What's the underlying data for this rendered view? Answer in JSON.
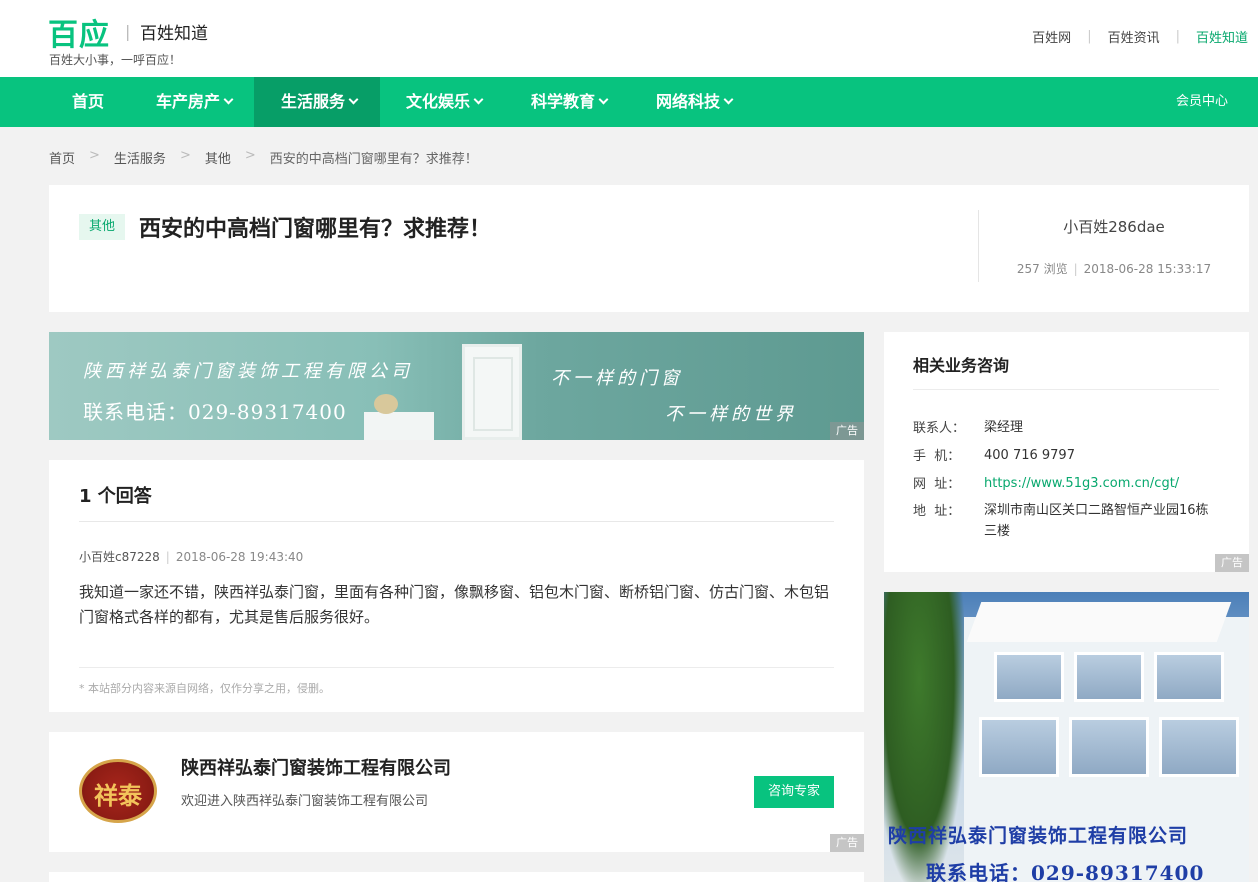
{
  "header": {
    "logo": "百应",
    "site_name": "百姓知道",
    "slogan": "百姓大小事，一呼百应！",
    "links": [
      "百姓网",
      "百姓资讯",
      "百姓知道"
    ]
  },
  "nav": {
    "items": [
      "首页",
      "车产房产",
      "生活服务",
      "文化娱乐",
      "科学教育",
      "网络科技"
    ],
    "active": "生活服务",
    "member": "会员中心"
  },
  "breadcrumb": [
    "首页",
    "生活服务",
    "其他",
    "西安的中高档门窗哪里有？求推荐！"
  ],
  "question": {
    "tag": "其他",
    "title": "西安的中高档门窗哪里有？求推荐！",
    "user": "小百姓286dae",
    "views": "257 浏览",
    "time": "2018-06-28 15:33:17"
  },
  "banner": {
    "company": "陕西祥弘泰门窗装饰工程有限公司",
    "phone": "联系电话：029-89317400",
    "slogan1": "不一样的门窗",
    "slogan2": "不一样的世界",
    "ad": "广告"
  },
  "answers": {
    "count": "1 个回答",
    "items": [
      {
        "user": "小百姓c87228",
        "time": "2018-06-28 19:43:40",
        "text": "我知道一家还不错，陕西祥弘泰门窗，里面有各种门窗，像飘移窗、铝包木门窗、断桥铝门窗、仿古门窗、木包铝门窗格式各样的都有，尤其是售后服务很好。"
      }
    ],
    "note": "* 本站部分内容来源自网络，仅作分享之用，侵删。"
  },
  "company_card": {
    "logo_text": "祥泰",
    "name": "陕西祥弘泰门窗装饰工程有限公司",
    "desc": "欢迎进入陕西祥弘泰门窗装饰工程有限公司",
    "button": "咨询专家",
    "ad": "广告"
  },
  "consult": {
    "title": "相关业务咨询",
    "rows": [
      {
        "k": "联系人：",
        "v": "梁经理"
      },
      {
        "k": "手  机：",
        "v": "400 716 9797"
      },
      {
        "k": "网  址：",
        "v": "https://www.51g3.com.cn/cgt/"
      },
      {
        "k": "地  址：",
        "v": "深圳市南山区关口二路智恒产业园16栋三楼"
      }
    ],
    "ad": "广告"
  },
  "side_ad": {
    "line1": "陕西祥弘泰门窗装饰工程有限公司",
    "line2": "联系电话：029-89317400"
  },
  "colors": {
    "brand_green": "#08c37f",
    "nav_active": "#079e67",
    "link_green": "#08a86e"
  }
}
